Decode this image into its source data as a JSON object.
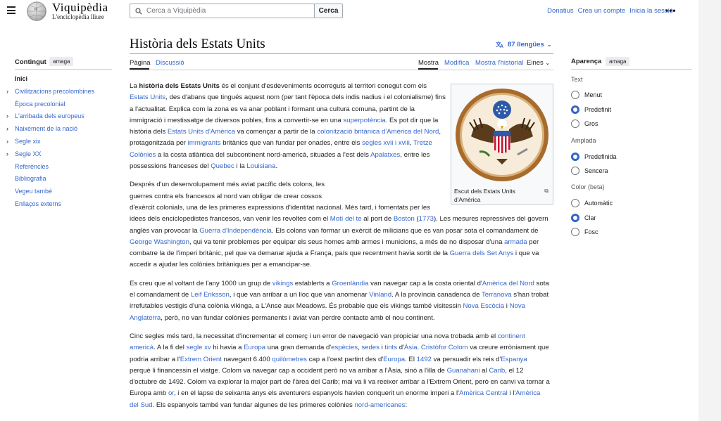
{
  "header": {
    "wordmark": "Viquipèdia",
    "tagline": "L'enciclopèdia lliure",
    "search_placeholder": "Cerca a Viquipèdia",
    "search_button": "Cerca",
    "user_links": [
      "Donatius",
      "Crea un compte",
      "Inicia la sessió"
    ],
    "more": "•••"
  },
  "page": {
    "title": "Història dels Estats Units",
    "languages": "87 llengües"
  },
  "tabs": {
    "article": "Pàgina",
    "talk": "Discussió",
    "read": "Mostra",
    "edit": "Modifica",
    "history": "Mostra l'historial",
    "tools": "Eines"
  },
  "toc": {
    "title": "Contingut",
    "hide": "amaga",
    "items": [
      {
        "label": "Inici",
        "chevron": false
      },
      {
        "label": "Civilitzacions precolombines",
        "chevron": true
      },
      {
        "label": "Època precolonial",
        "chevron": false
      },
      {
        "label": "L'arribada dels europeus",
        "chevron": true
      },
      {
        "label": "Naixement de la nació",
        "chevron": true
      },
      {
        "label": "Segle xix",
        "chevron": true
      },
      {
        "label": "Segle XX",
        "chevron": true
      },
      {
        "label": "Referències",
        "chevron": false
      },
      {
        "label": "Bibliografia",
        "chevron": false
      },
      {
        "label": "Vegeu també",
        "chevron": false
      },
      {
        "label": "Enllaços externs",
        "chevron": false
      }
    ]
  },
  "appearance": {
    "title": "Aparença",
    "hide": "amaga",
    "text_heading": "Text",
    "text_options": [
      "Menut",
      "Predefinit",
      "Gros"
    ],
    "text_selected": 1,
    "width_heading": "Amplada",
    "width_options": [
      "Predefinida",
      "Sencera"
    ],
    "width_selected": 0,
    "color_heading": "Color (beta)",
    "color_options": [
      "Automàtic",
      "Clar",
      "Fosc"
    ],
    "color_selected": 1
  },
  "figure": {
    "caption": "Escut dels Estats Units d'Amèrica"
  },
  "colors": {
    "link": "#3366cc",
    "text": "#202122",
    "strip": "#f3f3f3"
  },
  "paragraphs": [
    [
      {
        "t": "La "
      },
      {
        "t": "història dels Estats Units",
        "b": true
      },
      {
        "t": " és el conjunt d'esdeveniments ocorreguts al territori conegut com els "
      },
      {
        "t": "Estats Units",
        "l": true
      },
      {
        "t": ", des d'abans que tingués aquest nom (per tant l'època dels indis nadius i el colonialisme) fins a l'actualitat. Explica com la zona es va anar poblant i formant una cultura comuna, partint de la immigració i mestissatge de diversos pobles, fins a convertir-se en una "
      },
      {
        "t": "superpotència",
        "l": true
      },
      {
        "t": ". Es pot dir que la història dels "
      },
      {
        "t": "Estats Units d'Amèrica",
        "l": true
      },
      {
        "t": " va començar a partir de la "
      },
      {
        "t": "colonització britànica d'Amèrica del Nord",
        "l": true
      },
      {
        "t": ", protagonitzada per "
      },
      {
        "t": "immigrants",
        "l": true
      },
      {
        "t": " britànics que van fundar per onades, entre els "
      },
      {
        "t": "segles xvii i xviii",
        "l": true
      },
      {
        "t": ", "
      },
      {
        "t": "Tretze Colònies",
        "l": true
      },
      {
        "t": " a la costa atlàntica del subcontinent nord-americà, situades a l'est dels "
      },
      {
        "t": "Apalatxes",
        "l": true
      },
      {
        "t": ", entre les possessions franceses del "
      },
      {
        "t": "Quebec",
        "l": true
      },
      {
        "t": " i la "
      },
      {
        "t": "Louisiana",
        "l": true
      },
      {
        "t": "."
      }
    ],
    [
      {
        "t": "Després d'un desenvolupament més aviat pacífic dels colons, les guerres contra els francesos al nord van obligar de crear cossos d'exèrcit colonials, una de les primeres expressions d'identitat nacional. Més tard, i fomentats per les idees dels enciclopedistes francesos, van venir les revoltes com el "
      },
      {
        "t": "Motí del te",
        "l": true
      },
      {
        "t": " al port de "
      },
      {
        "t": "Boston",
        "l": true
      },
      {
        "t": " ("
      },
      {
        "t": "1773",
        "l": true
      },
      {
        "t": "). Les mesures repressives del govern anglès van provocar la "
      },
      {
        "t": "Guerra d'Independència",
        "l": true
      },
      {
        "t": ". Els colons van formar un exèrcit de milicians que es van posar sota el comandament de "
      },
      {
        "t": "George Washington",
        "l": true
      },
      {
        "t": ", qui va tenir problemes per equipar els seus homes amb armes i municions, a més de no disposar d'una "
      },
      {
        "t": "armada",
        "l": true
      },
      {
        "t": " per combatre la de l'imperi britànic, pel que va demanar ajuda a França, país que recentment havia sortit de la "
      },
      {
        "t": "Guerra dels Set Anys",
        "l": true
      },
      {
        "t": " i que va accedir a ajudar les colònies britàniques per a emancipar-se."
      }
    ],
    [
      {
        "t": "Es creu que al voltant de l'any 1000 un grup de "
      },
      {
        "t": "vikings",
        "l": true
      },
      {
        "t": " establerts a "
      },
      {
        "t": "Groenlàndia",
        "l": true
      },
      {
        "t": " van navegar cap a la costa oriental d'"
      },
      {
        "t": "Amèrica del Nord",
        "l": true
      },
      {
        "t": " sota el comandament de "
      },
      {
        "t": "Leif Eriksson",
        "l": true
      },
      {
        "t": ", i que van arribar a un lloc que van anomenar "
      },
      {
        "t": "Vinland",
        "l": true
      },
      {
        "t": ". A la província canadenca de "
      },
      {
        "t": "Terranova",
        "l": true
      },
      {
        "t": " s'han trobat irrefutables vestigis d'una colònia vikinga, a L'Anse aux Meadows. És probable que els vikings també visitessin "
      },
      {
        "t": "Nova Escòcia",
        "l": true
      },
      {
        "t": " i "
      },
      {
        "t": "Nova Anglaterra",
        "l": true
      },
      {
        "t": ", però, no van fundar colònies permanents i aviat van perdre contacte amb el nou continent."
      }
    ],
    [
      {
        "t": "Cinc segles més tard, la necessitat d'incrementar el comerç i un error de navegació van propiciar una nova trobada amb el "
      },
      {
        "t": "continent americà",
        "l": true
      },
      {
        "t": ". A la fi del "
      },
      {
        "t": "segle xv",
        "l": true
      },
      {
        "t": " hi havia a "
      },
      {
        "t": "Europa",
        "l": true
      },
      {
        "t": " una gran demanda d'"
      },
      {
        "t": "espècies",
        "l": true
      },
      {
        "t": ", "
      },
      {
        "t": "sedes",
        "l": true
      },
      {
        "t": " i "
      },
      {
        "t": "tints",
        "l": true
      },
      {
        "t": " d'"
      },
      {
        "t": "Àsia",
        "l": true
      },
      {
        "t": ". "
      },
      {
        "t": "Cristòfor Colom",
        "l": true
      },
      {
        "t": " va creure erròniament que podria arribar a l'"
      },
      {
        "t": "Extrem Orient",
        "l": true
      },
      {
        "t": " navegant 6.400 "
      },
      {
        "t": "quilòmetres",
        "l": true
      },
      {
        "t": " cap a l'oest partint des d'"
      },
      {
        "t": "Europa",
        "l": true
      },
      {
        "t": ". El "
      },
      {
        "t": "1492",
        "l": true
      },
      {
        "t": " va persuadir els reis d'"
      },
      {
        "t": "Espanya",
        "l": true
      },
      {
        "t": " perquè li financessin el viatge. Colom va navegar cap a occident però no va arribar a l'Àsia, sinó a l'illa de "
      },
      {
        "t": "Guanahani",
        "l": true
      },
      {
        "t": " al "
      },
      {
        "t": "Carib",
        "l": true
      },
      {
        "t": ", el 12 d'octubre de 1492. Colom va explorar la major part de l'àrea del Carib; mai va li va reeixer arribar a l'Extrem Orient, però en canvi va tornar a Europa amb "
      },
      {
        "t": "or",
        "l": true
      },
      {
        "t": ", i en el lapse de seixanta anys els aventurers espanyols havien conquerit un enorme imperi a l'"
      },
      {
        "t": "Amèrica Central",
        "l": true
      },
      {
        "t": " i l'"
      },
      {
        "t": "Amèrica del Sud",
        "l": true
      },
      {
        "t": ". Els espanyols també van fundar algunes de les primeres colònies "
      },
      {
        "t": "nord-americanes",
        "l": true
      },
      {
        "t": ":"
      }
    ]
  ]
}
